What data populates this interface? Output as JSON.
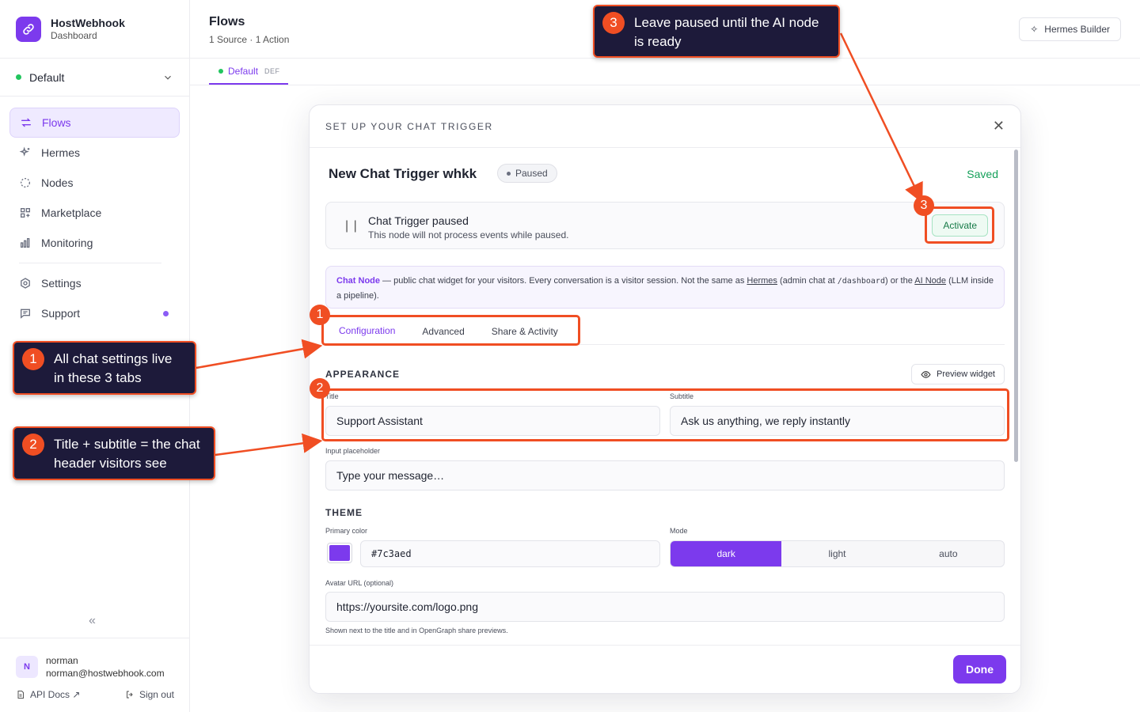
{
  "brand": {
    "name": "HostWebhook",
    "subtitle": "Dashboard"
  },
  "workspace": {
    "name": "Default"
  },
  "nav": [
    {
      "label": "Flows",
      "icon": "arrows-swap-icon",
      "active": true
    },
    {
      "label": "Hermes",
      "icon": "sparkles-icon"
    },
    {
      "label": "Nodes",
      "icon": "nodes-icon"
    },
    {
      "label": "Marketplace",
      "icon": "grid-icon"
    },
    {
      "label": "Monitoring",
      "icon": "bar-chart-icon"
    },
    {
      "label": "Settings",
      "icon": "gear-icon"
    },
    {
      "label": "Support",
      "icon": "chat-icon"
    }
  ],
  "user": {
    "initial": "N",
    "name": "norman",
    "email": "norman@hostwebhook.com",
    "api_docs": "API Docs ↗",
    "sign_out": "Sign out"
  },
  "header": {
    "title": "Flows",
    "subtitle": "1 Source · 1 Action",
    "builder_button": "Hermes Builder"
  },
  "flow_tab": {
    "label": "Default",
    "badge": "DEF"
  },
  "modal": {
    "heading": "SET UP YOUR CHAT TRIGGER",
    "node_title": "New Chat Trigger whkk",
    "status_pill": "Paused",
    "saved": "Saved",
    "pause_title": "Chat Trigger paused",
    "pause_desc": "This node will not process events while paused.",
    "activate": "Activate",
    "info": {
      "bold": "Chat Node",
      "text1": " — public chat widget for your visitors. Every conversation is a visitor session. Not the same as ",
      "link1": "Hermes",
      "text2": " (admin chat at ",
      "code": "/dashboard",
      "text3": ") or the ",
      "link2": "AI Node",
      "text4": " (LLM inside a pipeline)."
    },
    "tabs": [
      "Configuration",
      "Advanced",
      "Share & Activity"
    ],
    "appearance_label": "APPEARANCE",
    "preview_button": "Preview widget",
    "title_label": "Title",
    "title_value": "Support Assistant",
    "subtitle_label": "Subtitle",
    "subtitle_value": "Ask us anything, we reply instantly",
    "placeholder_label": "Input placeholder",
    "placeholder_value": "Type your message…",
    "theme_label": "THEME",
    "primary_color_label": "Primary color",
    "primary_color": "#7c3aed",
    "mode_label": "Mode",
    "modes": [
      "dark",
      "light",
      "auto"
    ],
    "mode_selected": "dark",
    "avatar_label": "Avatar URL (optional)",
    "avatar_value": "https://yoursite.com/logo.png",
    "avatar_hint": "Shown next to the title and in OpenGraph share previews.",
    "done": "Done"
  },
  "annotations": [
    {
      "num": "1",
      "text": "All chat settings live in these 3 tabs"
    },
    {
      "num": "2",
      "text": "Title + subtitle = the chat header visitors see"
    },
    {
      "num": "3",
      "text": "Leave paused until the AI node is ready"
    }
  ],
  "colors": {
    "accent": "#7c3aed",
    "annotation": "#f04e23",
    "callout_bg": "#1d1a3a",
    "saved": "#15a05a"
  }
}
